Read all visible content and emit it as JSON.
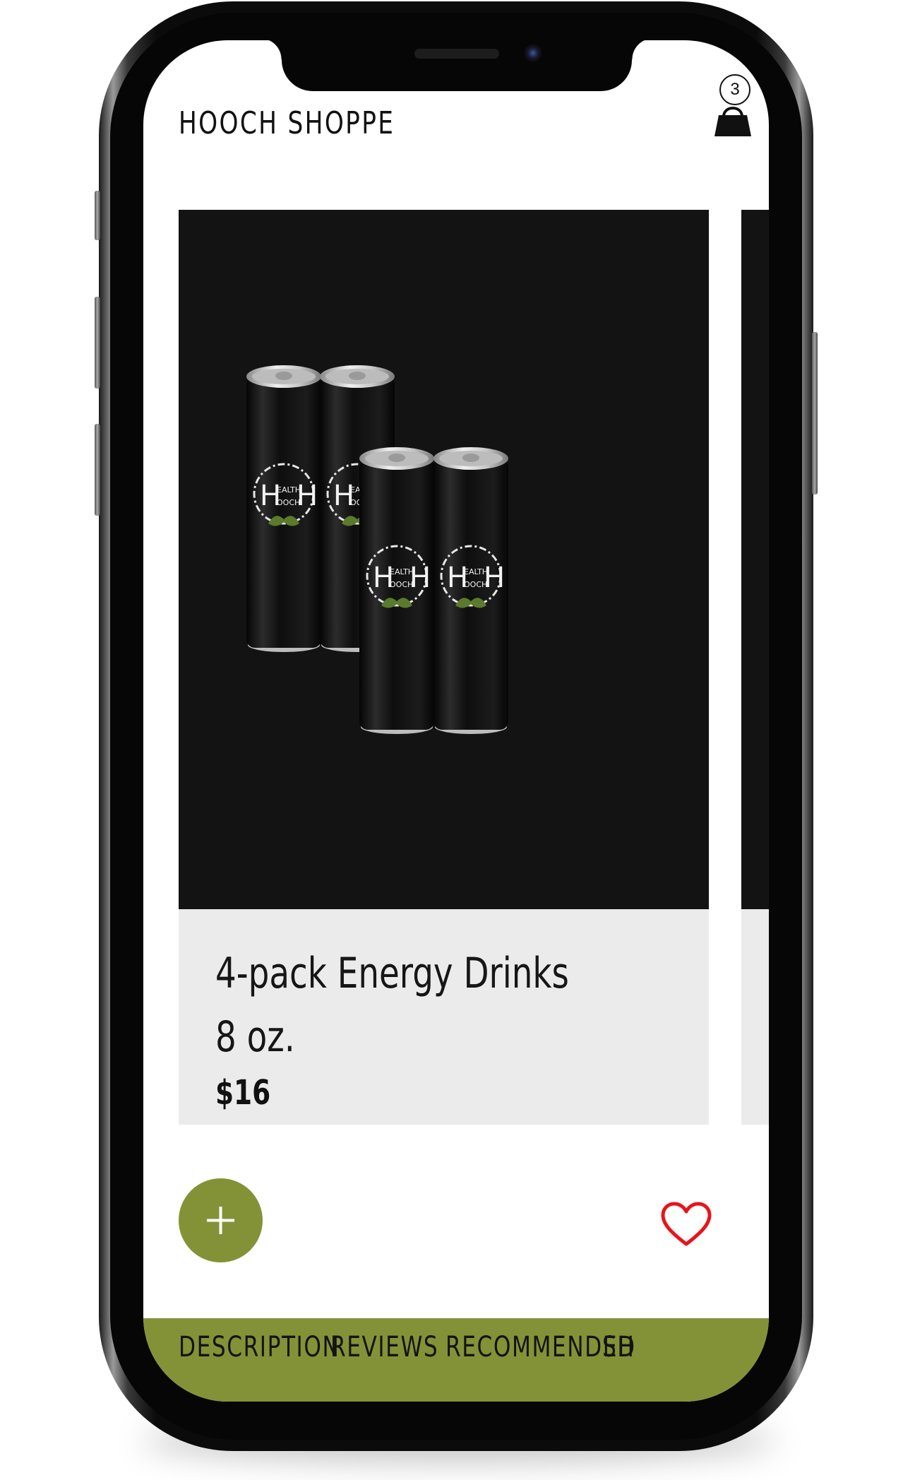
{
  "header": {
    "store_name": "HOOCH SHOPPE",
    "cart_icon": "shopping-bag-icon",
    "cart_count": "3"
  },
  "product": {
    "name": "4-pack Energy Drinks",
    "size": "8 oz.",
    "price": "$16",
    "image_alt": "Four black Health Hooch energy drink cans",
    "can_logo_text": "HEALTH HOOCH"
  },
  "actions": {
    "add_icon": "plus-icon",
    "favorite_icon": "heart-icon"
  },
  "tabs": [
    {
      "label": "DESCRIPTION"
    },
    {
      "label": "REVIEWS"
    },
    {
      "label": "RECOMMENDED"
    },
    {
      "label": "SH"
    }
  ],
  "colors": {
    "accent_green": "#849237",
    "card_dark": "#131313",
    "card_info_bg": "#ebebeb",
    "heart_red": "#e8141b"
  }
}
